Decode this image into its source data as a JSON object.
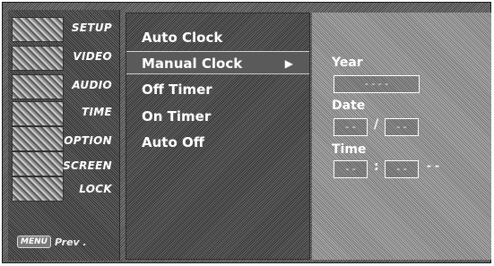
{
  "sidebar": {
    "items": [
      {
        "label": "SETUP"
      },
      {
        "label": "VIDEO"
      },
      {
        "label": "AUDIO"
      },
      {
        "label": "TIME"
      },
      {
        "label": "OPTION"
      },
      {
        "label": "SCREEN"
      },
      {
        "label": "LOCK"
      }
    ],
    "menu_key_label": "MENU",
    "prev_label": "Prev ."
  },
  "menu": {
    "items": [
      {
        "label": "Auto Clock"
      },
      {
        "label": "Manual Clock"
      },
      {
        "label": "Off Timer"
      },
      {
        "label": "On Timer"
      },
      {
        "label": "Auto Off"
      }
    ],
    "arrow_icon": "right-triangle-icon"
  },
  "right": {
    "year_label": "Year",
    "year_value": "- - - -",
    "date_label": "Date",
    "date_month": "- -",
    "date_sep": "/",
    "date_day": "- -",
    "time_label": "Time",
    "time_hour": "- -",
    "time_sep": ":",
    "time_min": "- -",
    "time_ampm": "- -"
  }
}
